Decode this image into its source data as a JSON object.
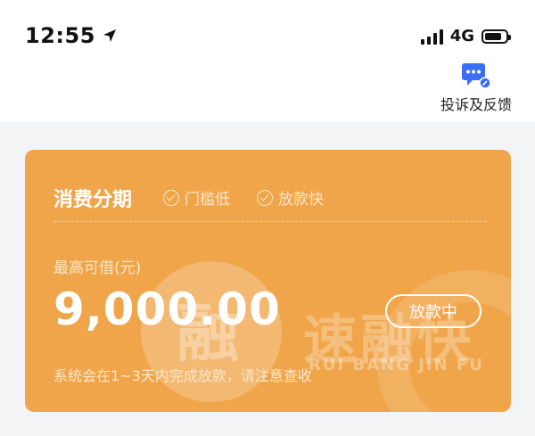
{
  "status_bar": {
    "time": "12:55",
    "network": "4G"
  },
  "header": {
    "feedback_label": "投诉及反馈"
  },
  "card": {
    "title": "消费分期",
    "tags": [
      "门槛低",
      "放款快"
    ],
    "limit_label": "最高可借(元)",
    "amount": "9,000.00",
    "status": "放款中",
    "notice": "系统会在1~3天内完成放款，请注意查收",
    "watermark": {
      "glyph": "融",
      "brand": "速融快",
      "brand_pinyin": "RUI BANG JIN FU"
    }
  },
  "colors": {
    "card_bg": "#f0a54a",
    "feedback_icon": "#3b6ef5"
  }
}
